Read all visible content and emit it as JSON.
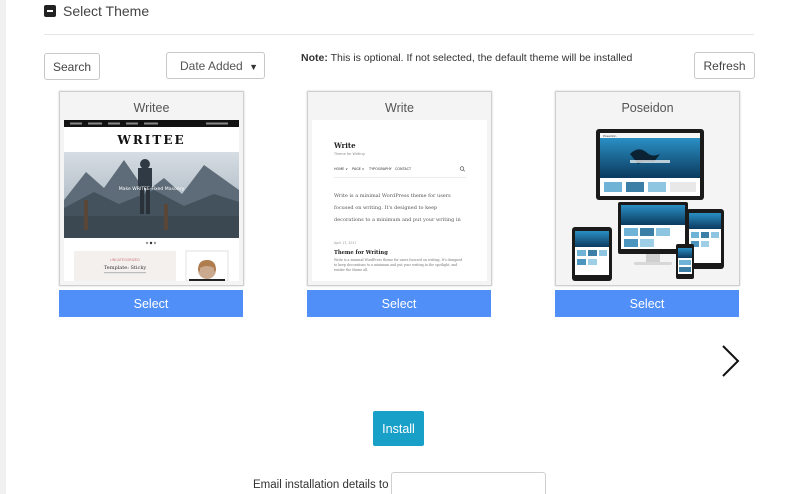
{
  "section": {
    "title": "Select Theme"
  },
  "toolbar": {
    "search_label": "Search",
    "sort_value": "Date Added",
    "note_label": "Note:",
    "note_text": "This is optional. If not selected, the default theme will be installed",
    "refresh_label": "Refresh"
  },
  "themes": [
    {
      "name": "Writee",
      "select_label": "Select",
      "preview": {
        "logo": "WRITEE",
        "hero_text": "Make WRITEE Fixed Masonry",
        "card_tag": "UNCATEGORIZED",
        "card_title": "Template: Sticky"
      }
    },
    {
      "name": "Write",
      "select_label": "Select",
      "preview": {
        "site_title": "Write",
        "tagline": "Theme for Writing",
        "nav": [
          "HOME ∨",
          "PAGE ∨",
          "TYPOGRAPHY",
          "CONTACT"
        ],
        "intro": "Write is a minimal WordPress theme for users focused on writing. It's designed to keep decorations to a minimum and put your writing in the spotlight.",
        "post_date": "April 13, 2017",
        "post_title": "Theme for Writing",
        "post_excerpt": "Write is a minimal WordPress theme for users focused on writing. It's designed to keep decorations to a minimum and put your writing in the spotlight, and render the theme all."
      }
    },
    {
      "name": "Poseidon",
      "select_label": "Select",
      "preview": {
        "logo": "Poseidon"
      }
    }
  ],
  "install": {
    "label": "Install"
  },
  "email": {
    "label": "Email installation details to :",
    "value": "",
    "placeholder": ""
  },
  "colors": {
    "select_button": "#4f8ff7",
    "install_button": "#19a0c9"
  },
  "icons": {
    "collapse": "minus-square-icon",
    "next": "chevron-right-icon",
    "search_preview": "search-icon"
  }
}
